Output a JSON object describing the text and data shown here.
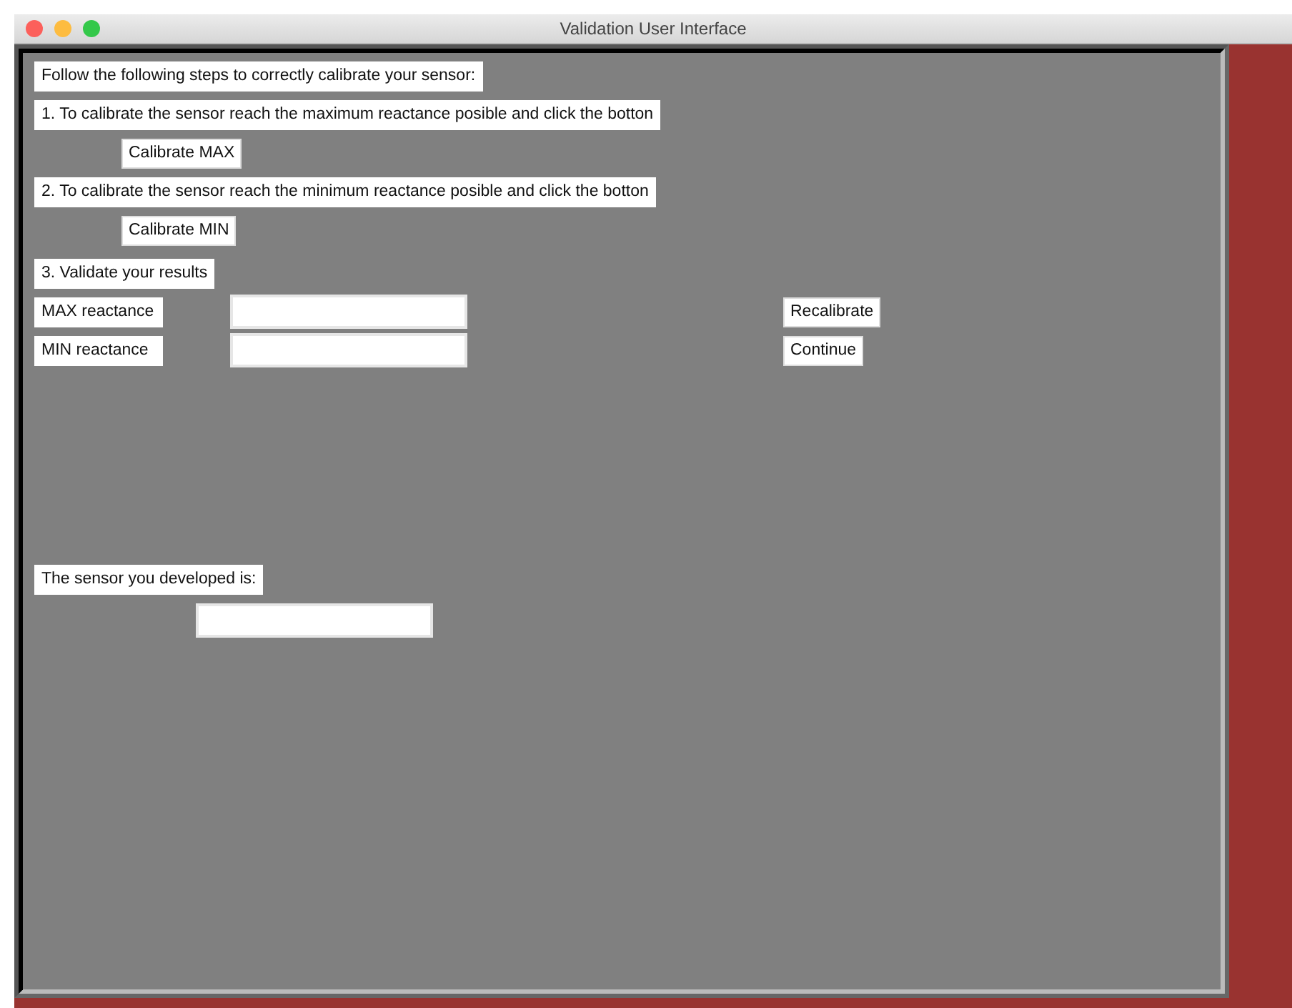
{
  "window": {
    "title": "Validation User Interface"
  },
  "intro": "Follow the following steps to correctly calibrate your sensor:",
  "steps": [
    {
      "text": "1. To calibrate the sensor reach the maximum reactance posible and click the botton",
      "button": "Calibrate MAX"
    },
    {
      "text": "2. To calibrate the sensor reach the minimum reactance posible and click the botton",
      "button": "Calibrate MIN"
    }
  ],
  "validate": {
    "title": "3. Validate your results",
    "rows": [
      {
        "label": "MAX reactance",
        "button": "Recalibrate"
      },
      {
        "label": "MIN reactance",
        "button": "Continue"
      }
    ]
  },
  "result": {
    "label": "The sensor you developed is:"
  }
}
